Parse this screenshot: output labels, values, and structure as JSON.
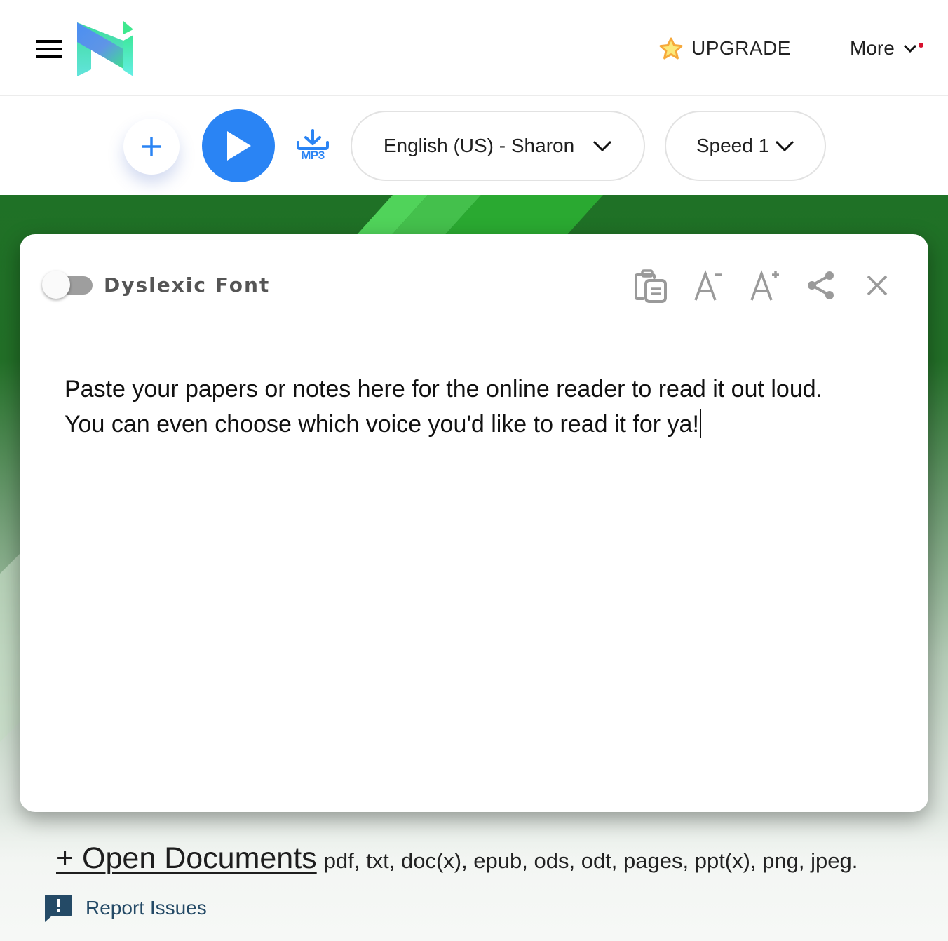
{
  "header": {
    "menu_icon": "hamburger-icon",
    "logo": "naturalreader-logo",
    "upgrade": {
      "icon": "star-icon",
      "label": "UPGRADE"
    },
    "more": {
      "label": "More",
      "icon": "chevron-down-icon",
      "has_notification": true
    }
  },
  "toolbar": {
    "add_icon": "plus-icon",
    "play_icon": "play-icon",
    "mp3": {
      "icon": "download-icon",
      "label": "MP3"
    },
    "voice": {
      "selected": "English (US) - Sharon",
      "icon": "chevron-down-icon"
    },
    "speed": {
      "selected": "Speed 1",
      "icon": "chevron-down-icon"
    }
  },
  "editor_card": {
    "dyslexic_toggle": {
      "label": "Dyslexic Font",
      "checked": false
    },
    "tools": [
      {
        "name": "paste",
        "icon": "clipboard-paste-icon"
      },
      {
        "name": "decrease-font",
        "icon": "font-decrease-icon"
      },
      {
        "name": "increase-font",
        "icon": "font-increase-icon"
      },
      {
        "name": "share",
        "icon": "share-icon"
      },
      {
        "name": "close",
        "icon": "close-icon"
      }
    ],
    "text_lines": [
      "Paste your papers or notes here for the online reader to read it out loud.",
      "You can even choose which voice you'd like to read it for ya!"
    ]
  },
  "footer": {
    "open_documents": "+ Open Documents",
    "supported_types": "pdf, txt, doc(x), epub, ods, odt, pages, ppt(x), png, jpeg.",
    "report_issues": "Report Issues"
  },
  "colors": {
    "accent_blue": "#2a84f4",
    "notification_red": "#d7112e",
    "hero_green": "#1f7126",
    "report_text": "#244a66"
  }
}
